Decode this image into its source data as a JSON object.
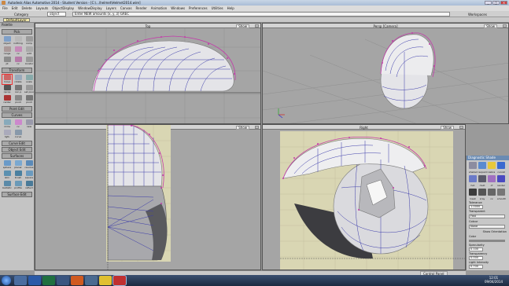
{
  "window": {
    "title": "Autodesk Alias Automotive 2014 - Student Version - [C:\\...\\helmet\\Helmet2014.wire]"
  },
  "menu": [
    "File",
    "Edit",
    "Delete",
    "Layouts",
    "ObjectDisplay",
    "WindowDisplay",
    "Layers",
    "Canvas",
    "Render",
    "Animation",
    "Windows",
    "Preferences",
    "Utilities",
    "Help"
  ],
  "toolbar": {
    "category_label": "Category",
    "category_value": "object",
    "prompt_placeholder": "Enter NEW amounts (x, y, z) GREC",
    "workspaces_label": "Workspaces",
    "default_layer": "DefaultLayer"
  },
  "palette": {
    "title": "Palette",
    "sections": [
      {
        "name": "Pick",
        "tools": [
          "object",
          "nothing",
          "comp",
          "range",
          "cv",
          "edit",
          "pt",
          "cv",
          "locator"
        ]
      },
      {
        "name": "Transform",
        "tools": [
          "move",
          "rotate",
          "scale",
          "nprop",
          "non p",
          "set pivot",
          "center",
          "pivot",
          "pivot"
        ]
      },
      {
        "name": "Point Edit",
        "tools": []
      },
      {
        "name": "Curves",
        "tools": [
          "circle",
          "cv",
          "new",
          "tgfs",
          "curve"
        ]
      },
      {
        "name": "Curve Edit",
        "tools": []
      },
      {
        "name": "Object Edit",
        "tools": []
      },
      {
        "name": "Surfaces",
        "tools": [
          "sphere",
          "planar",
          "revolve",
          "skin",
          "brush",
          "square",
          "ballistic",
          "profile",
          "reflect",
          "sweep",
          "fillet",
          "rail",
          "freeform"
        ]
      },
      {
        "name": "Surface Edit",
        "tools": []
      }
    ],
    "selected_tool": "move"
  },
  "viewports": [
    {
      "name": "Top",
      "show_label": "Show"
    },
    {
      "name": "Persp [Camera]",
      "show_label": "Show"
    },
    {
      "name": "Front",
      "show_label": "Show"
    },
    {
      "name": "Right",
      "show_label": "Show"
    }
  ],
  "right_panel": {
    "title": "Diagnostic Shade",
    "mode_labels": [
      "shaded",
      "isoparm",
      "zebra",
      "curvat"
    ],
    "mode_labels2": [
      "hot",
      "mult",
      "cf",
      "render"
    ],
    "mode_labels3": [
      "mesh",
      "xray",
      "cv",
      "smooth"
    ],
    "tolerance_label": "Tolerance",
    "tolerance_value": "1.0000",
    "transparency_label": "Transparent",
    "transparency_value": "Fast",
    "color_mode_label": "Colour",
    "color_mode_value": "None",
    "show_orientation_label": "Show Orientation",
    "color_label": "Color",
    "specularity_label": "Specularity",
    "specularity_value": "0.100",
    "transparency2_label": "Transparency",
    "transparency2_value": "0.000",
    "light_intensity_label": "Light Intensity",
    "light_intensity_value": "0.700"
  },
  "status": {
    "control_panel": "Control Panel"
  },
  "taskbar": {
    "time": "12:01",
    "date": "09/04/2014"
  },
  "colors": {
    "cv_magenta": "#c33caa",
    "iso_blue": "#3a3aaa",
    "surface": "#e2e2e6",
    "bg": "#a5a5a5",
    "image_plane": "#d9d6b3"
  }
}
